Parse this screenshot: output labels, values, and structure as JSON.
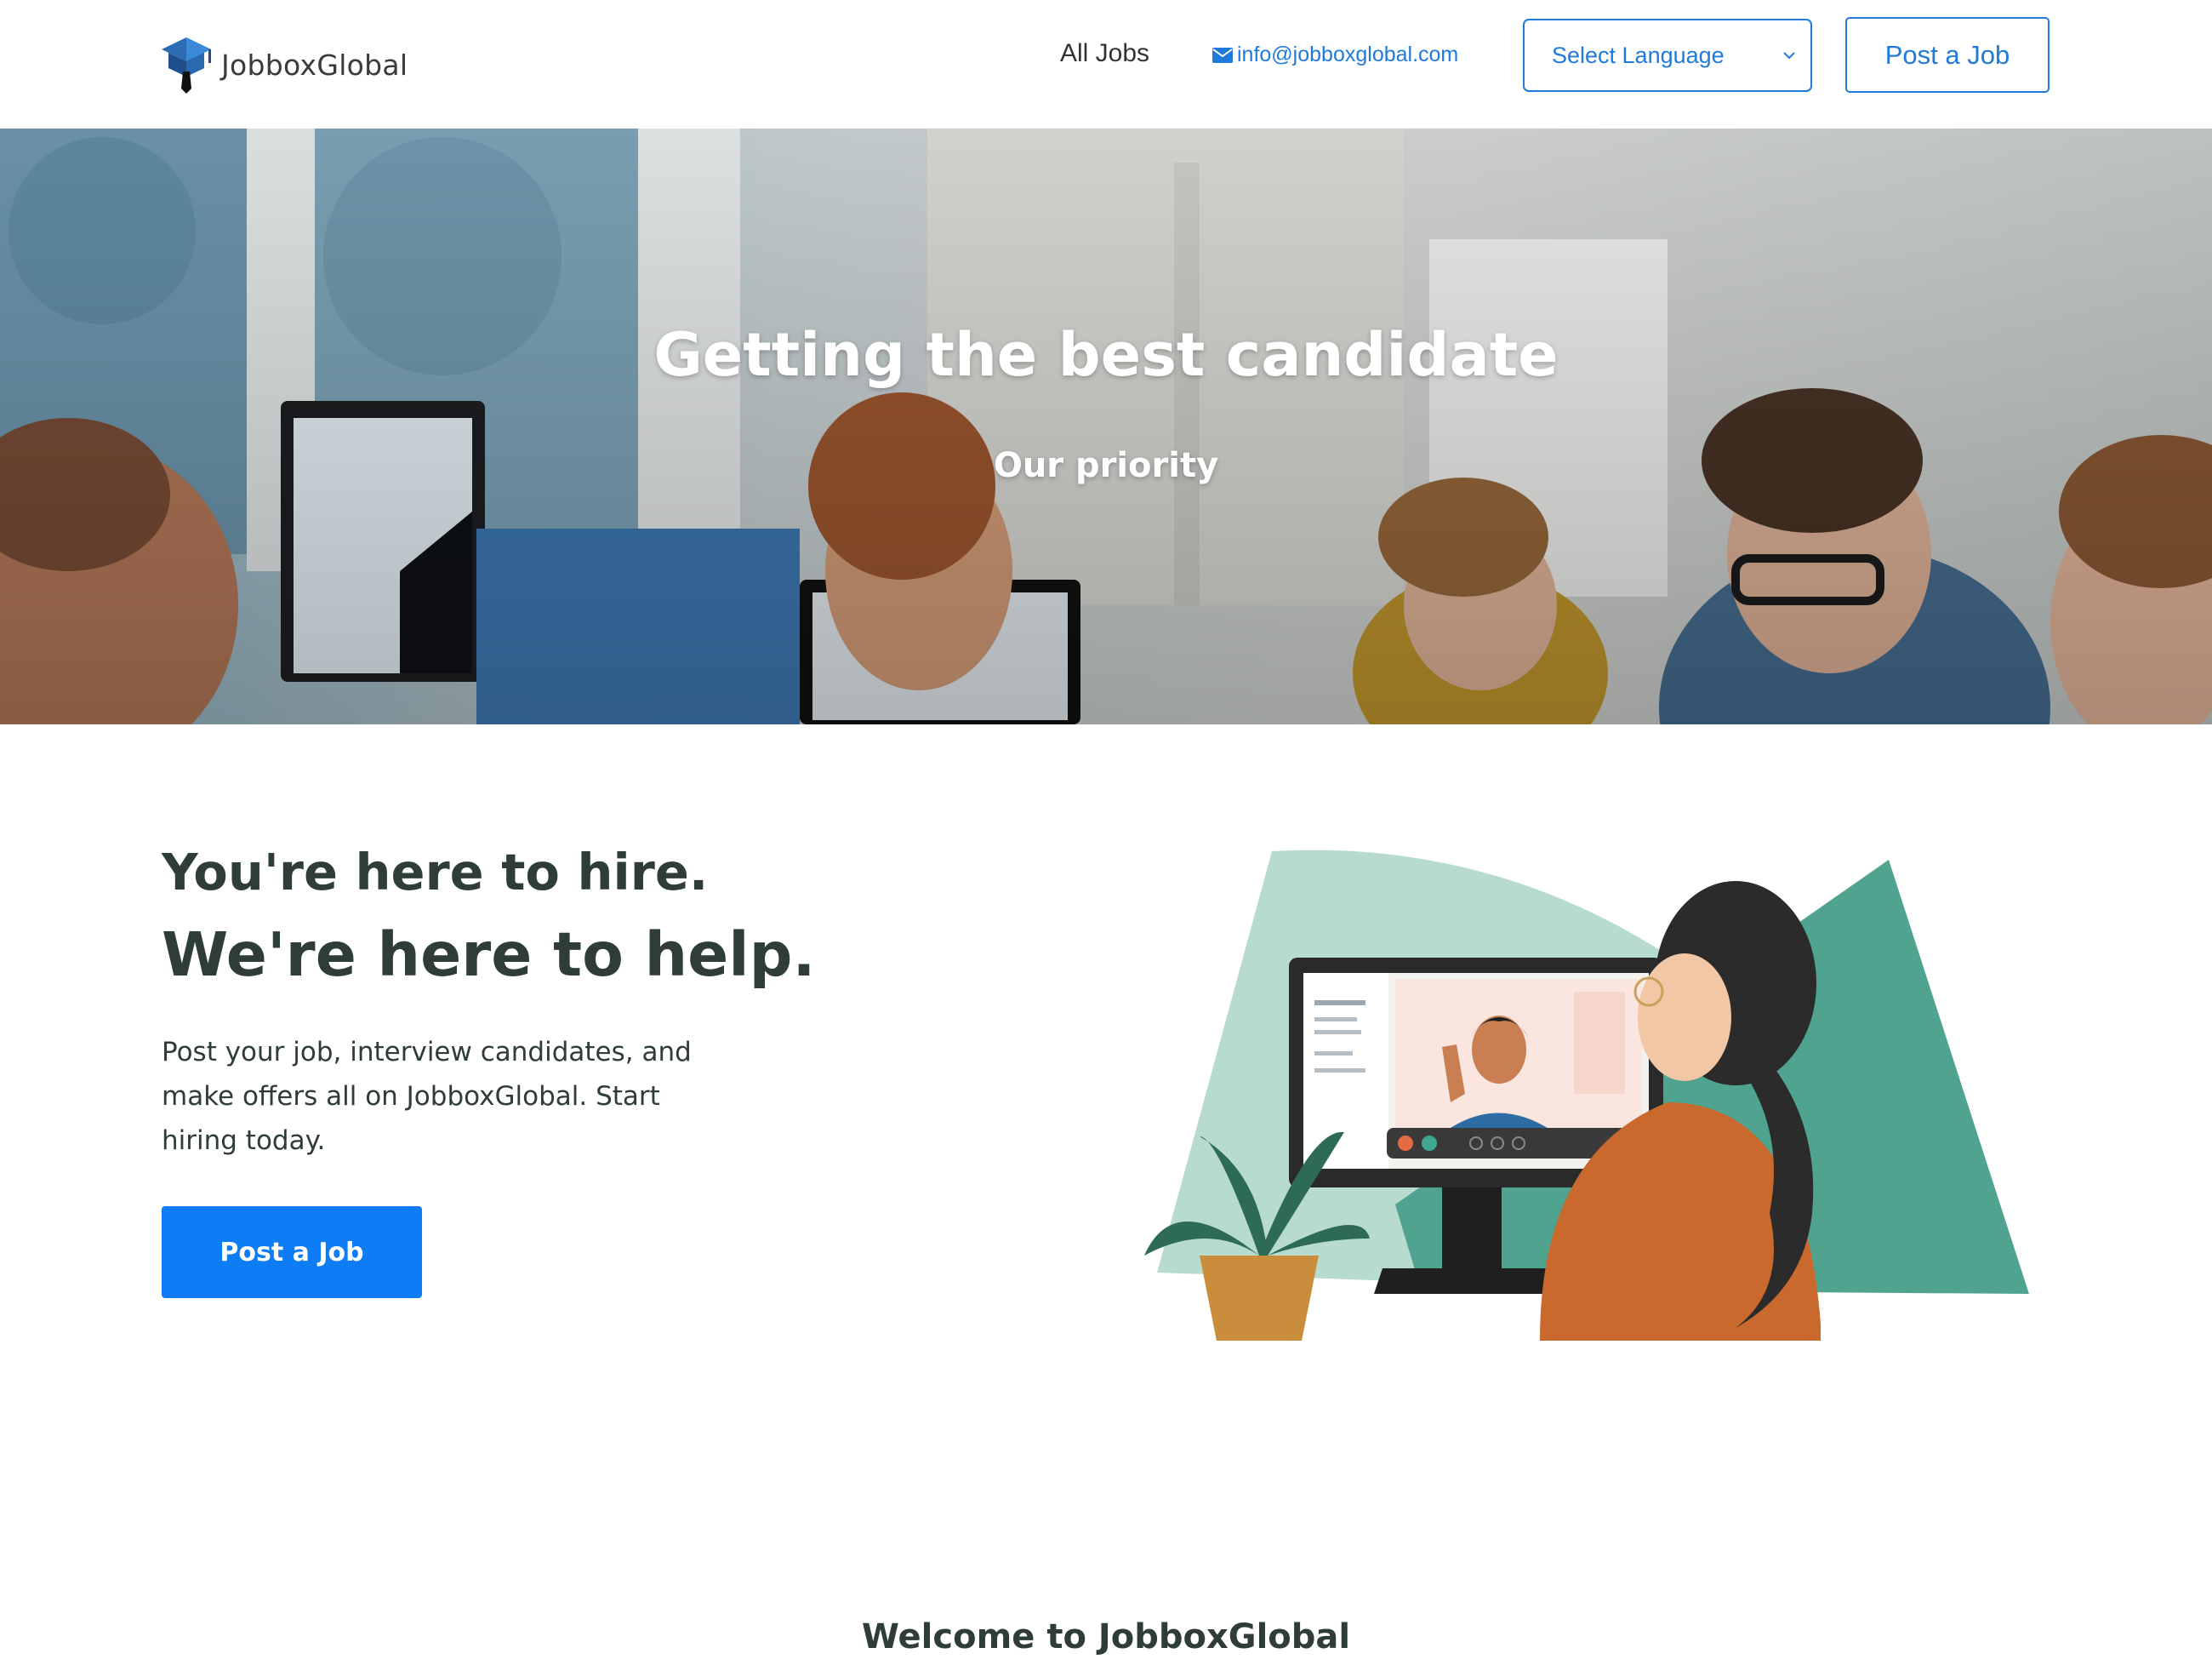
{
  "header": {
    "brand": "JobboxGlobal",
    "nav_all_jobs": "All Jobs",
    "email": "info@jobboxglobal.com",
    "language_select": "Select Language",
    "post_job_label": "Post a Job"
  },
  "hero": {
    "title": "Getting the best candidate",
    "subtitle": "Our priority"
  },
  "hire": {
    "heading_line1": "You're here to hire.",
    "heading_line2": "We're here to help.",
    "text_line1": "Post your job, interview candidates, and",
    "text_line2": "make offers all on JobboxGlobal. Start",
    "text_line3": "hiring today.",
    "button_label": "Post a Job"
  },
  "welcome": {
    "heading": "Welcome to JobboxGlobal"
  },
  "colors": {
    "accent": "#1f7ad9",
    "primary_button": "#0d7cf5",
    "heading_text": "#2f3d3a"
  },
  "icons": [
    "graduation-cap-logo-icon",
    "envelope-icon",
    "chevron-down-icon"
  ]
}
